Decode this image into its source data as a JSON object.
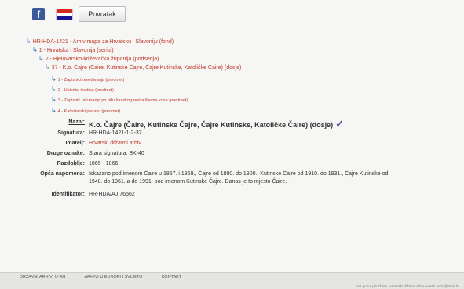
{
  "header": {
    "back_label": "Povratak"
  },
  "tree": [
    {
      "text": "HR-HDA-1421 - Arhiv mapa za Hrvatsku i Slavoniju (fond)"
    },
    {
      "text": "1 - Hrvatska i Slavonija (serija)"
    },
    {
      "text": "2 - Bjelovarsko-križevačka županija (podserija)"
    },
    {
      "text": "37 - K.o. Čajre (Čaire, Kutinske Čajre, Čajre Kutinske, Katoličke Čaire) (dosje)"
    },
    {
      "text": "1 - Zapisnici omeđivanja (predmet)"
    },
    {
      "text": "2 - Upisnici čestica (predmet)"
    },
    {
      "text": "3 - Zapisnik računanja po riđu šanskog revira Kavna kosa (predmet)"
    },
    {
      "text": "4 - Katastarski planovi (predmet)"
    }
  ],
  "details": {
    "naziv_label": "Naziv:",
    "naziv_value": "K.o. Čajre (Čaire, Kutinske Čajre, Čajre Kutinske, Katoličke Čaire) (dosje)",
    "signatura_label": "Signatura:",
    "signatura_value": "HR-HDA-1421-1-2-37",
    "imatelj_label": "Imatelj:",
    "imatelj_value": "Hrvatski državni arhiv",
    "druge_label": "Druge oznake:",
    "druge_value": "Stara signatura: BK-40",
    "razdoblje_label": "Razdoblje:",
    "razdoblje_value": "1865 - 1866",
    "opca_label": "Opća napomena:",
    "opca_value_line1": "Iskazano pod imenom Čaire u 1857. i 1869., Čajre od 1880. do 1900., Kutinske Čajre od 1910. do 1931., Čajre Kutinske od",
    "opca_value_line2": "1948. do 1961.,a do 1991. pod imenom Kutinske Čajre. Danas je to mjesto Čaire.",
    "identifikator_label": "Identifikator:",
    "identifikator_value": "HR-HDA/AJ 76562"
  },
  "footer": {
    "links": [
      "DRŽAVNI ARHIVI U RH",
      "ARHIVI U EUROPI I SVIJETU",
      "KONTAKT"
    ],
    "note": "Sva prava pridržana - Hrvatski državni arhiv e-mail: arhiv@arhiv.hr"
  }
}
